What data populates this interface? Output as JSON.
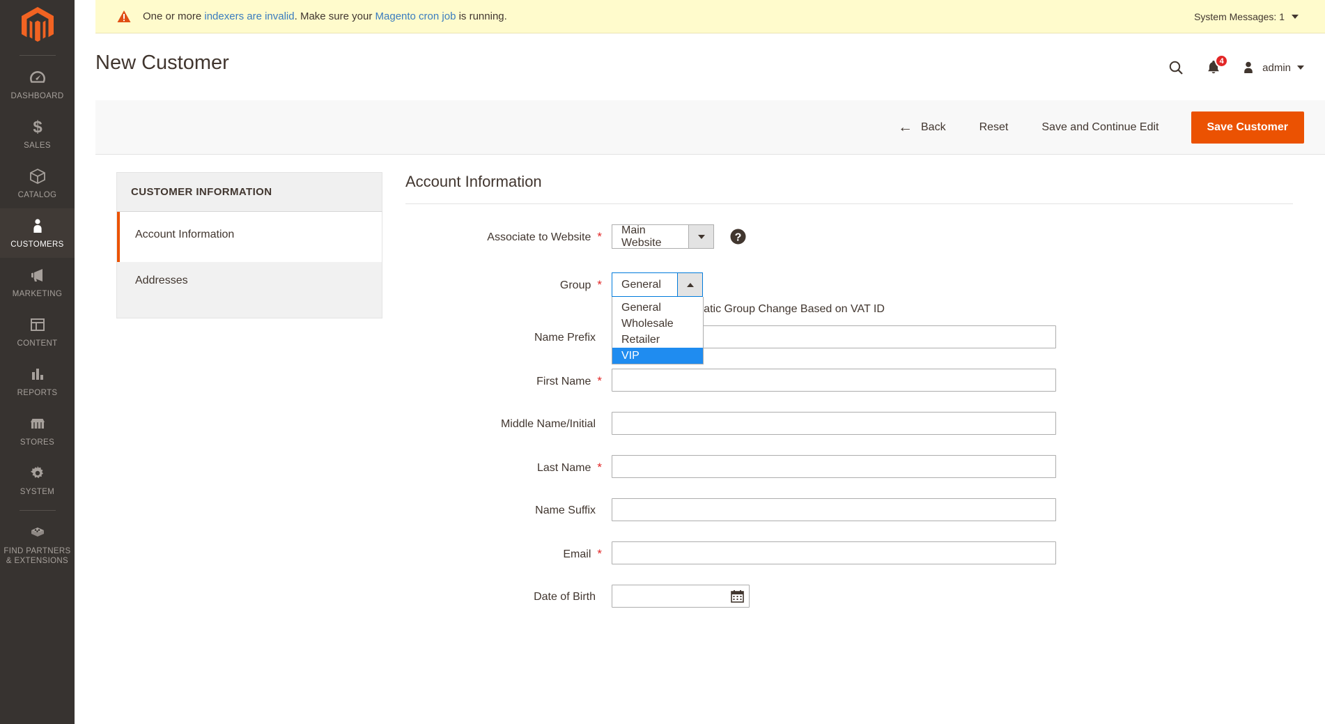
{
  "sidebar": {
    "logo_name": "magento-logo",
    "items": [
      {
        "label": "Dashboard",
        "icon": "dashboard-icon",
        "active": false
      },
      {
        "label": "Sales",
        "icon": "dollar-icon",
        "active": false
      },
      {
        "label": "Catalog",
        "icon": "box-icon",
        "active": false
      },
      {
        "label": "Customers",
        "icon": "person-icon",
        "active": true
      },
      {
        "label": "Marketing",
        "icon": "megaphone-icon",
        "active": false
      },
      {
        "label": "Content",
        "icon": "layout-icon",
        "active": false
      },
      {
        "label": "Reports",
        "icon": "bar-chart-icon",
        "active": false
      },
      {
        "label": "Stores",
        "icon": "storefront-icon",
        "active": false
      },
      {
        "label": "System",
        "icon": "gear-icon",
        "active": false
      },
      {
        "label": "Find Partners\n& Extensions",
        "icon": "extension-box-icon",
        "active": false
      }
    ]
  },
  "message_bar": {
    "icon": "warning-triangle-icon",
    "text_part1": "One or more ",
    "link1": "indexers are invalid",
    "text_part2": ". Make sure your ",
    "link2": "Magento cron job",
    "text_part3": " is running.",
    "system_messages_label": "System Messages: 1"
  },
  "header": {
    "title": "New Customer",
    "search_icon": "search-icon",
    "notifications_icon": "bell-icon",
    "notifications_count": "4",
    "user_icon": "user-avatar-icon",
    "user_name": "admin"
  },
  "toolbar": {
    "back_label": "Back",
    "back_arrow": "←",
    "reset_label": "Reset",
    "save_continue_label": "Save and Continue Edit",
    "save_label": "Save Customer"
  },
  "side_panel": {
    "title": "CUSTOMER INFORMATION",
    "items": [
      {
        "label": "Account Information",
        "active": true
      },
      {
        "label": "Addresses",
        "active": false
      }
    ]
  },
  "form": {
    "section_title": "Account Information",
    "website": {
      "label": "Associate to Website",
      "required": "*",
      "value": "Main Website",
      "help_icon": "question-mark-icon"
    },
    "group": {
      "label": "Group",
      "required": "*",
      "value": "General",
      "expanded": true,
      "options": [
        {
          "label": "General",
          "selected": false
        },
        {
          "label": "Wholesale",
          "selected": false
        },
        {
          "label": "Retailer",
          "selected": false
        },
        {
          "label": "VIP",
          "selected": true
        }
      ]
    },
    "vat_checkbox": {
      "label": "Disable Automatic Group Change Based on VAT ID",
      "checked": false
    },
    "fields": [
      {
        "label": "Name Prefix",
        "required": "",
        "value": "",
        "type": "text"
      },
      {
        "label": "First Name",
        "required": "*",
        "value": "",
        "type": "text"
      },
      {
        "label": "Middle Name/Initial",
        "required": "",
        "value": "",
        "type": "text"
      },
      {
        "label": "Last Name",
        "required": "*",
        "value": "",
        "type": "text"
      },
      {
        "label": "Name Suffix",
        "required": "",
        "value": "",
        "type": "text"
      },
      {
        "label": "Email",
        "required": "*",
        "value": "",
        "type": "text"
      },
      {
        "label": "Date of Birth",
        "required": "",
        "value": "",
        "type": "date"
      }
    ]
  },
  "colors": {
    "accent_orange": "#eb5202",
    "nav_bg": "#373330",
    "warning_bg": "#fffbcc",
    "link_blue": "#3a7cbf",
    "select_blue": "#1f8cf0",
    "focus_blue": "#007bdb",
    "badge_red": "#e22626"
  }
}
